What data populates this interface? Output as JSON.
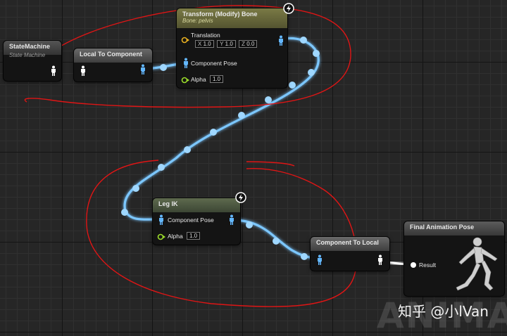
{
  "nodes": {
    "state_machine": {
      "title": "StateMachine",
      "subtitle": "State Machine"
    },
    "local_to_component": {
      "title": "Local To Component"
    },
    "transform_bone": {
      "title": "Transform (Modify) Bone",
      "subtitle": "Bone: pelvis",
      "translation_label": "Translation",
      "x": "1.0",
      "y": "1.0",
      "z": "0.0",
      "x_label": "X",
      "y_label": "Y",
      "z_label": "Z",
      "pose_label": "Component Pose",
      "alpha_label": "Alpha",
      "alpha_value": "1.0"
    },
    "leg_ik": {
      "title": "Leg IK",
      "pose_label": "Component Pose",
      "alpha_label": "Alpha",
      "alpha_value": "1.0"
    },
    "component_to_local": {
      "title": "Component To Local"
    },
    "final_pose": {
      "title": "Final Animation Pose",
      "result_label": "Result"
    }
  },
  "watermark": {
    "text": "知乎 @小lVan",
    "bg_text": "ANIMATI"
  },
  "colors": {
    "wire": "#8fd3ff",
    "wire_glow": "#3aa0e8",
    "annotation": "#e21212",
    "pose_pin": "#63b7ff",
    "alpha_pin": "#9bdc2a"
  }
}
